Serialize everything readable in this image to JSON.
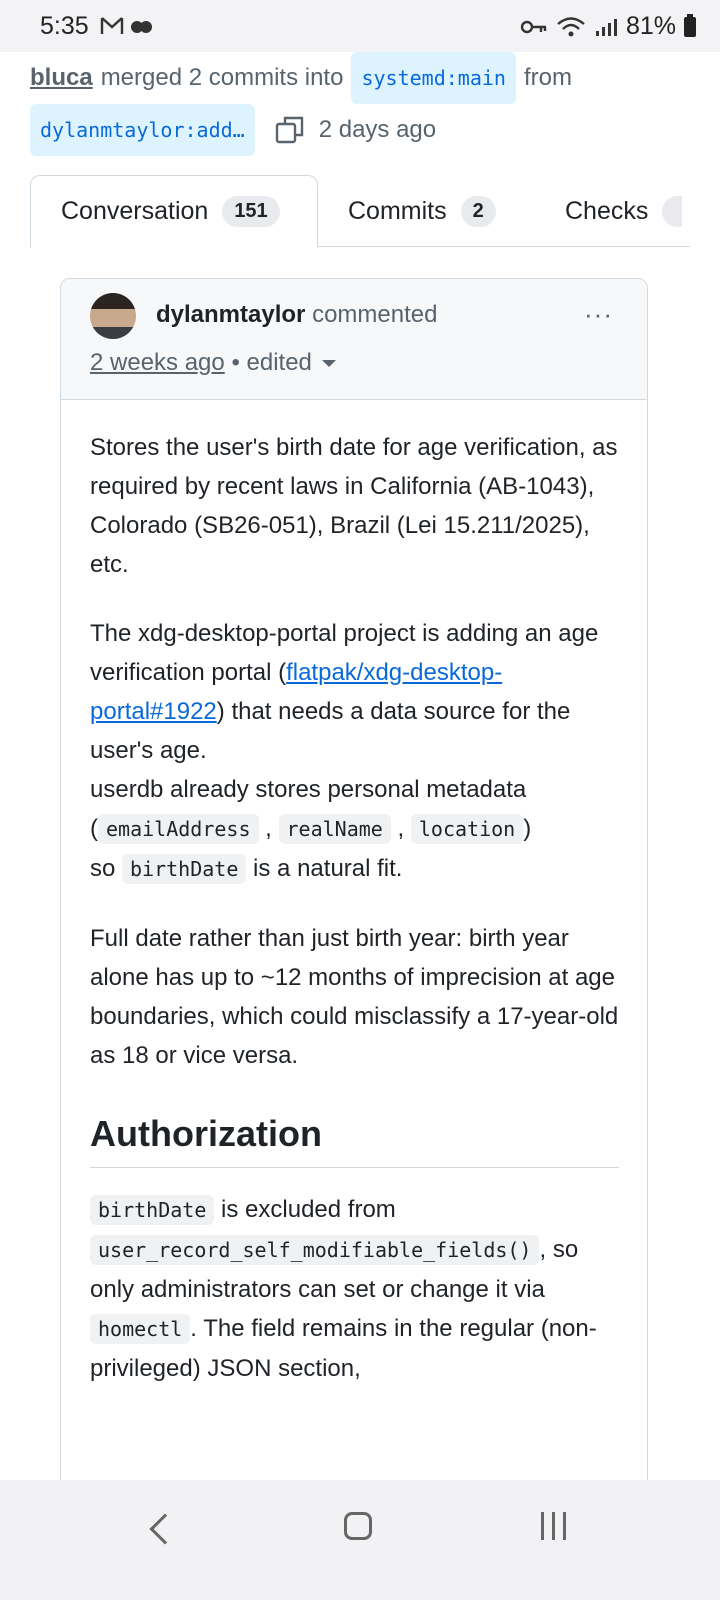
{
  "status_bar": {
    "time": "5:35",
    "battery": "81%",
    "icons": [
      "gmail-icon",
      "cloud-icon",
      "key-icon",
      "wifi-icon",
      "signal-icon",
      "battery-icon"
    ]
  },
  "pr_header": {
    "user": "bluca",
    "text_merged": "merged 2 commits into",
    "base_branch": "systemd:main",
    "text_from": "from",
    "head_branch": "dylanmtaylor:add…",
    "time_ago": "2 days ago"
  },
  "tabs": [
    {
      "label": "Conversation",
      "count": "151"
    },
    {
      "label": "Commits",
      "count": "2"
    },
    {
      "label": "Checks",
      "count": ""
    }
  ],
  "comment": {
    "author": "dylanmtaylor",
    "action": "commented",
    "time_ago": "2 weeks ago",
    "edited": "edited",
    "more": "···",
    "p1": "Stores the user's birth date for age verification, as required by recent laws in California (AB-1043), Colorado (SB26-051), Brazil (Lei 15.211/2025), etc.",
    "p2_a": "The xdg-desktop-portal project is adding an age verification portal (",
    "p2_link": "flatpak/xdg-desktop-portal#1922",
    "p2_b": ") that needs a data source for the user's age.",
    "p2_c": "userdb already stores personal metadata (",
    "code_email": "emailAddress",
    "code_realname": "realName",
    "code_location": "location",
    "p2_d": ")",
    "p2_e": "so ",
    "code_birthdate": "birthDate",
    "p2_f": " is a natural fit.",
    "p3": "Full date rather than just birth year: birth year alone has up to ~12 months of imprecision at age boundaries, which could misclassify a 17-year-old as 18 or vice versa.",
    "heading": "Authorization",
    "p4_code1": "birthDate",
    "p4_a": " is excluded from",
    "p4_code2": "user_record_self_modifiable_fields()",
    "p4_b": ", so only administrators can set or change it via ",
    "p4_code3": "homectl",
    "p4_c": ". The field remains in the regular (non-privileged) JSON section,"
  }
}
